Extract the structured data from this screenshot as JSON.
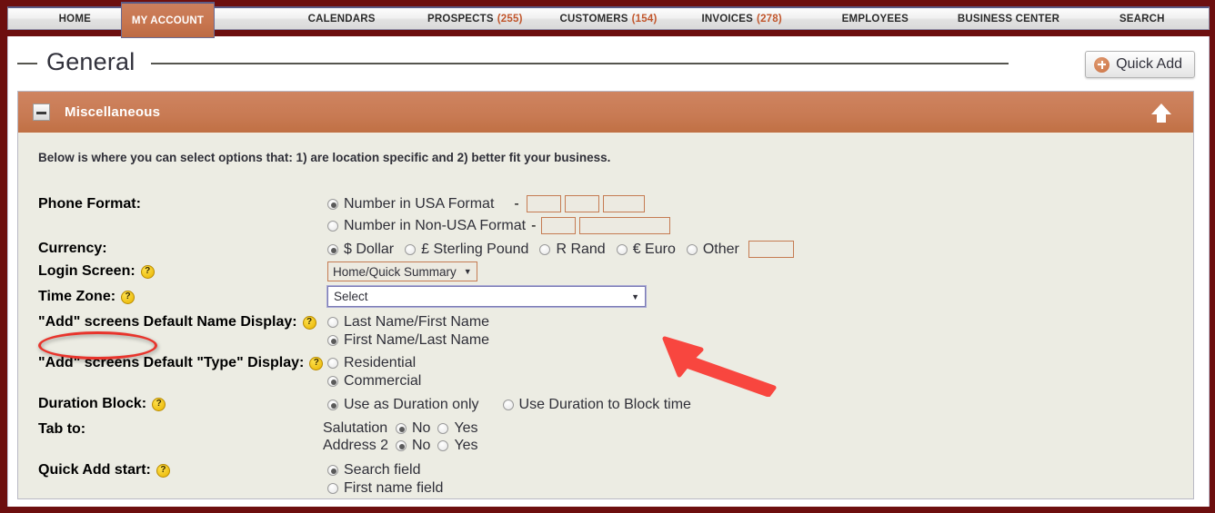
{
  "nav": {
    "tabs": [
      {
        "label": "HOME",
        "count": "",
        "active": false
      },
      {
        "label": "MY ACCOUNT",
        "count": "",
        "active": true
      },
      {
        "label": "CALENDARS",
        "count": "",
        "active": false
      },
      {
        "label": "PROSPECTS",
        "count": "(255)",
        "active": false
      },
      {
        "label": "CUSTOMERS",
        "count": "(154)",
        "active": false
      },
      {
        "label": "INVOICES",
        "count": "(278)",
        "active": false
      },
      {
        "label": "EMPLOYEES",
        "count": "",
        "active": false
      },
      {
        "label": "BUSINESS CENTER",
        "count": "",
        "active": false
      },
      {
        "label": "SEARCH",
        "count": "",
        "active": false
      }
    ]
  },
  "header": {
    "title": "General",
    "quick_add_label": "Quick Add",
    "quick_add_icon": "plus-circle-icon"
  },
  "panel": {
    "title": "Miscellaneous",
    "collapse_icon": "minus-icon",
    "scroll_top_icon": "arrow-up-icon"
  },
  "form": {
    "intro": "Below is where you can select options that: 1) are location specific and 2) better fit your business.",
    "phone_format": {
      "label": "Phone Format:",
      "options": [
        {
          "label": "Number in USA Format",
          "selected": true
        },
        {
          "label": "Number in Non-USA Format",
          "selected": false
        }
      ],
      "separator": "-"
    },
    "currency": {
      "label": "Currency:",
      "options": [
        {
          "label": "$ Dollar",
          "selected": true
        },
        {
          "label": "£ Sterling Pound",
          "selected": false
        },
        {
          "label": "R Rand",
          "selected": false
        },
        {
          "label": "€ Euro",
          "selected": false
        },
        {
          "label": "Other",
          "selected": false
        }
      ],
      "other_value": ""
    },
    "login_screen": {
      "label": "Login Screen:",
      "help_icon": "question-mark-icon",
      "value": "Home/Quick Summary",
      "caret": "▼"
    },
    "time_zone": {
      "label": "Time Zone:",
      "help_icon": "question-mark-icon",
      "value": "Select",
      "caret": "▼"
    },
    "name_display": {
      "label": "\"Add\" screens Default Name Display:",
      "help_icon": "question-mark-icon",
      "options": [
        {
          "label": "Last Name/First Name",
          "selected": false
        },
        {
          "label": "First Name/Last Name",
          "selected": true
        }
      ]
    },
    "type_display": {
      "label": "\"Add\" screens Default \"Type\" Display:",
      "help_icon": "question-mark-icon",
      "options": [
        {
          "label": "Residential",
          "selected": false
        },
        {
          "label": "Commercial",
          "selected": true
        }
      ]
    },
    "duration_block": {
      "label": "Duration Block:",
      "help_icon": "question-mark-icon",
      "options": [
        {
          "label": "Use as Duration only",
          "selected": true
        },
        {
          "label": "Use Duration to Block time",
          "selected": false
        }
      ]
    },
    "tab_to": {
      "label": "Tab to:",
      "rows": [
        {
          "name": "Salutation",
          "options": [
            {
              "label": "No",
              "selected": true
            },
            {
              "label": "Yes",
              "selected": false
            }
          ]
        },
        {
          "name": "Address 2",
          "options": [
            {
              "label": "No",
              "selected": true
            },
            {
              "label": "Yes",
              "selected": false
            }
          ]
        }
      ]
    },
    "quick_add_start": {
      "label": "Quick Add start:",
      "help_icon": "question-mark-icon",
      "options": [
        {
          "label": "Search field",
          "selected": true
        },
        {
          "label": "First name field",
          "selected": false
        }
      ]
    }
  },
  "annotations": {
    "ellipse_target": "Time Zone:",
    "arrow_target": "Select",
    "color": "#F8463F",
    "ellipse_color": "#E8342C"
  }
}
